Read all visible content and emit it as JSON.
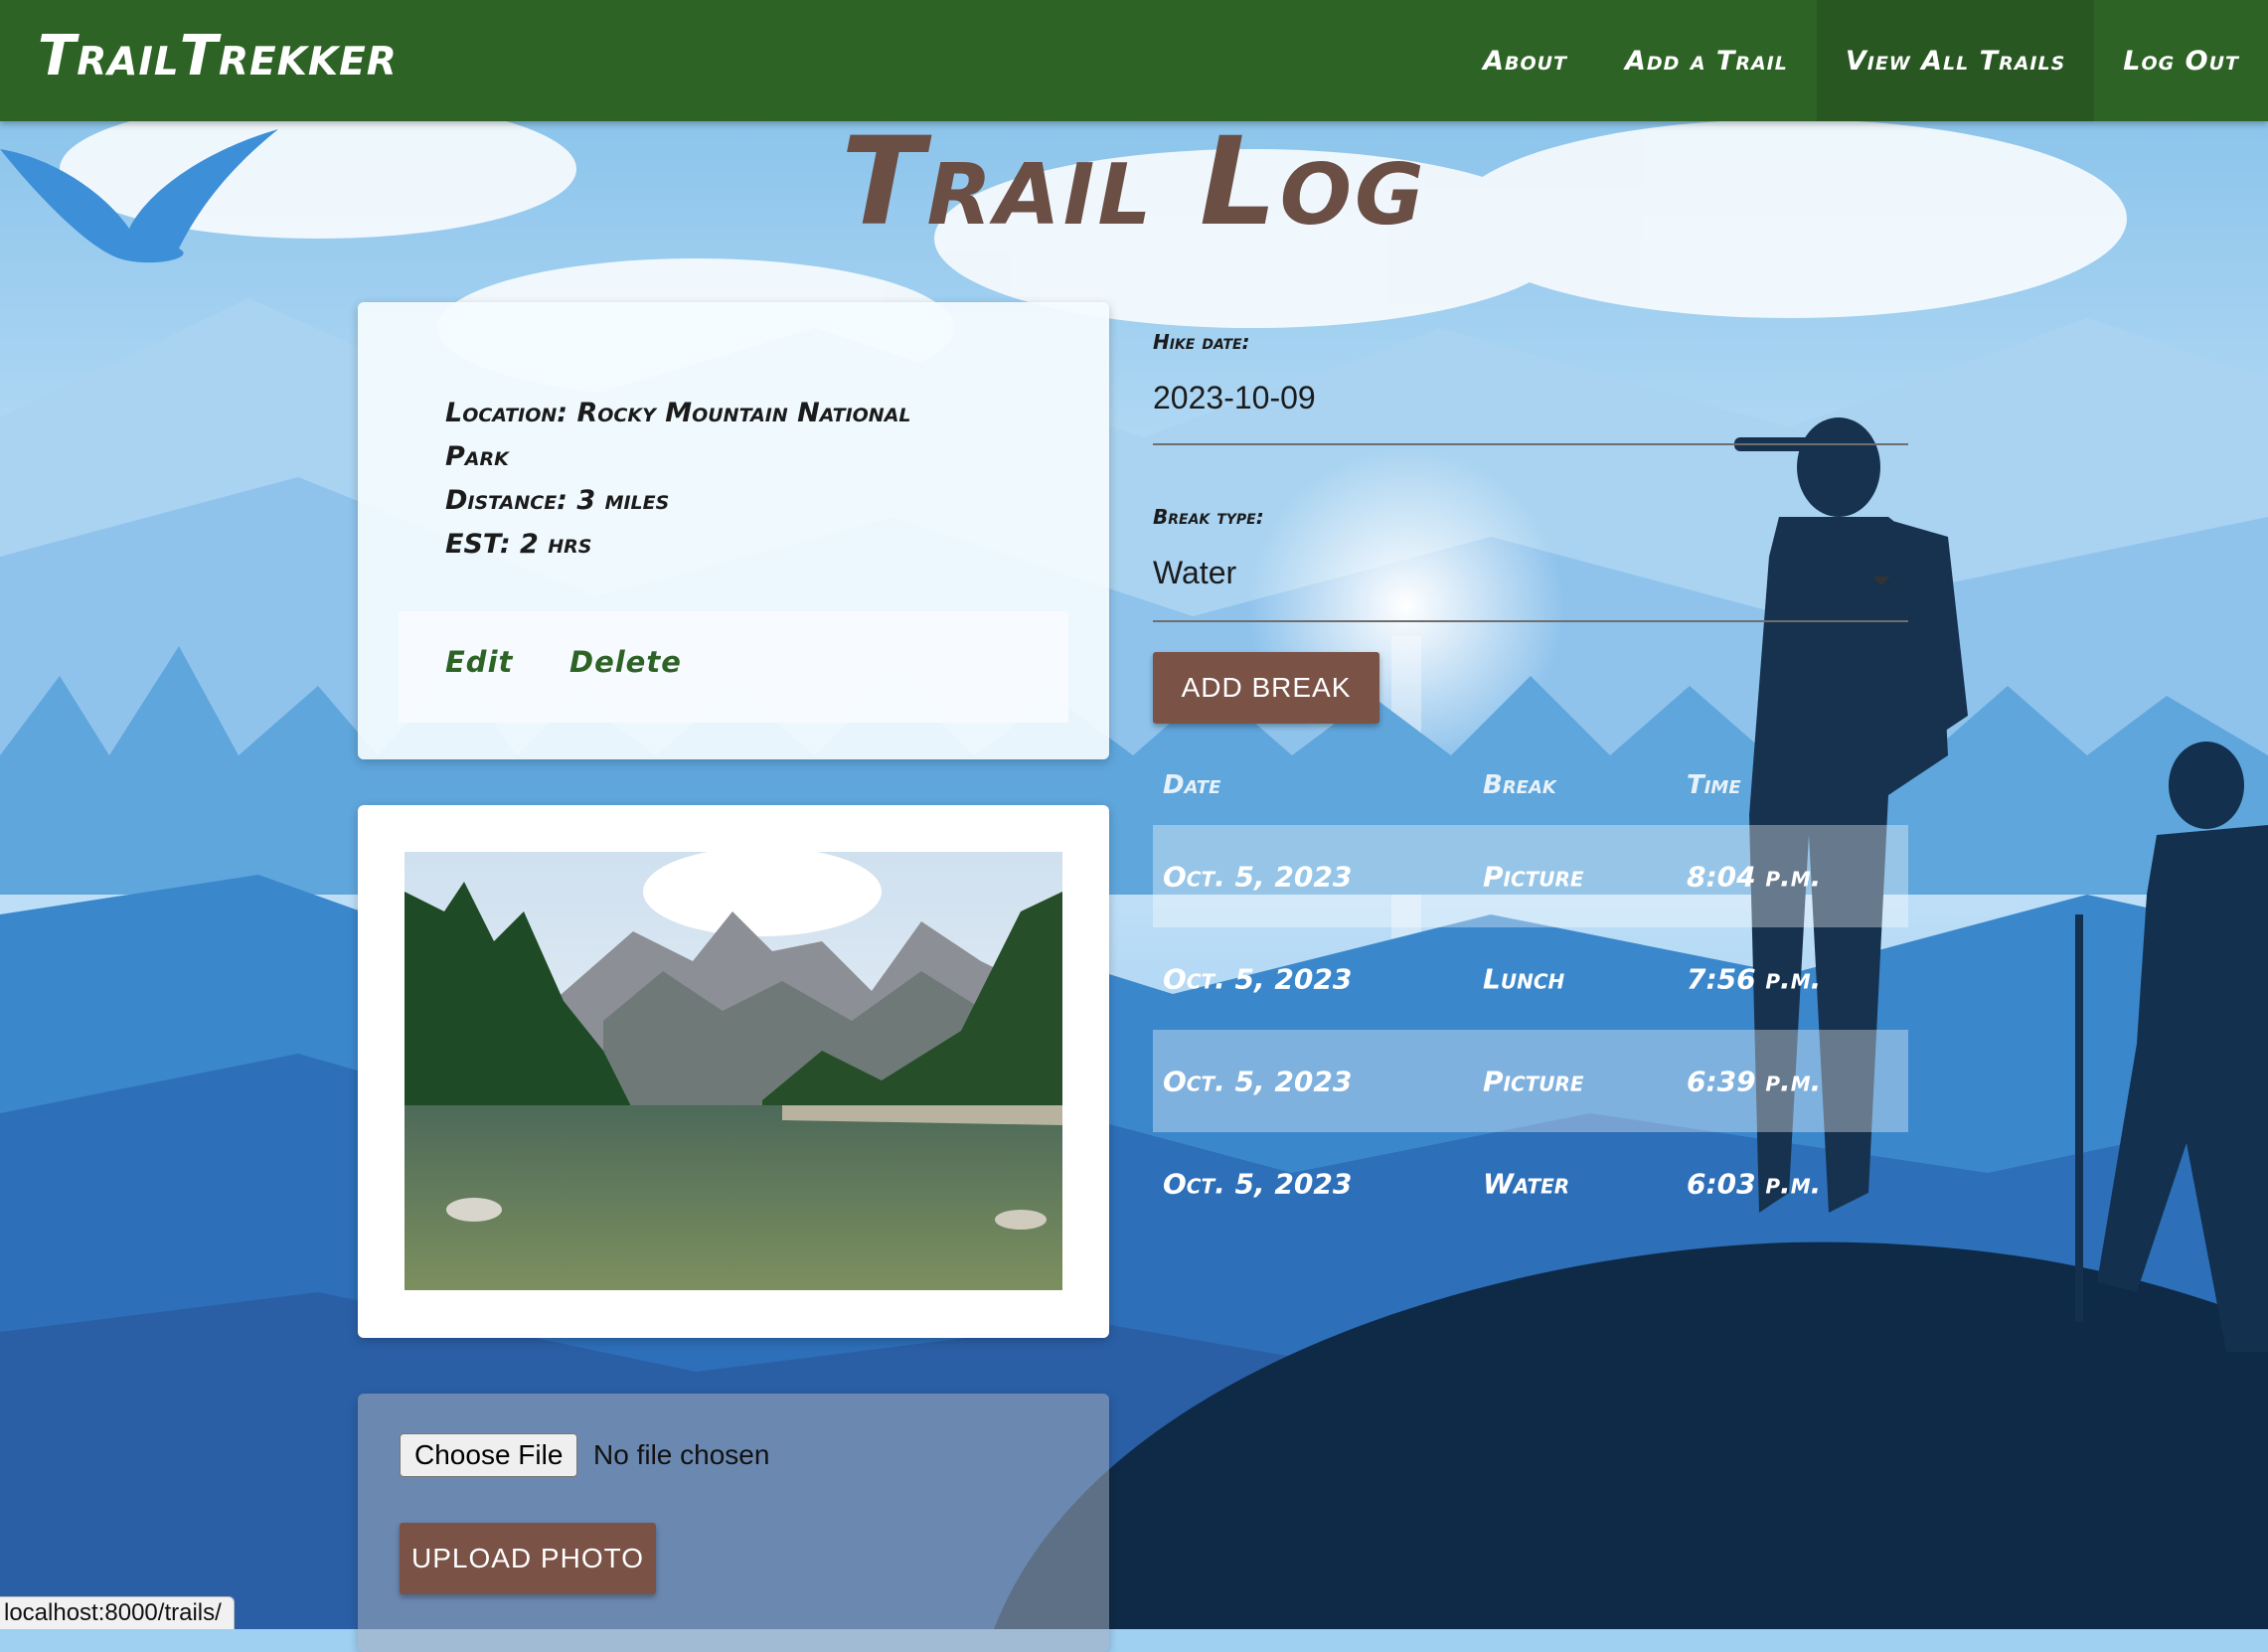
{
  "nav": {
    "brand": "TrailTrekker",
    "links": [
      "About",
      "Add a Trail",
      "View All Trails",
      "Log Out"
    ],
    "active_index": 2
  },
  "page": {
    "title": "Trail Log"
  },
  "trail_card": {
    "location_line1": "Location: Rocky Mountain National",
    "location_line2": "Park",
    "distance": "Distance: 3 miles",
    "est": "EST: 2 hrs",
    "edit_label": "Edit",
    "delete_label": "Delete"
  },
  "upload": {
    "choose_file_label": "Choose File",
    "file_status": "No file chosen",
    "upload_label": "UPLOAD PHOTO"
  },
  "break_form": {
    "hike_date_label": "Hike date:",
    "hike_date_value": "2023-10-09",
    "break_type_label": "Break type:",
    "break_type_value": "Water",
    "add_label": "ADD BREAK"
  },
  "breaks_table": {
    "headers": [
      "Date",
      "Break",
      "Time"
    ],
    "rows": [
      [
        "Oct. 5, 2023",
        "Picture",
        "8:04 p.m."
      ],
      [
        "Oct. 5, 2023",
        "Lunch",
        "7:56 p.m."
      ],
      [
        "Oct. 5, 2023",
        "Picture",
        "6:39 p.m."
      ],
      [
        "Oct. 5, 2023",
        "Water",
        "6:03 p.m."
      ]
    ]
  },
  "status_bar": {
    "url": "localhost:8000/trails/"
  },
  "colors": {
    "nav": "#2e6326",
    "brown": "#7a5246",
    "title": "#6b4f45"
  }
}
